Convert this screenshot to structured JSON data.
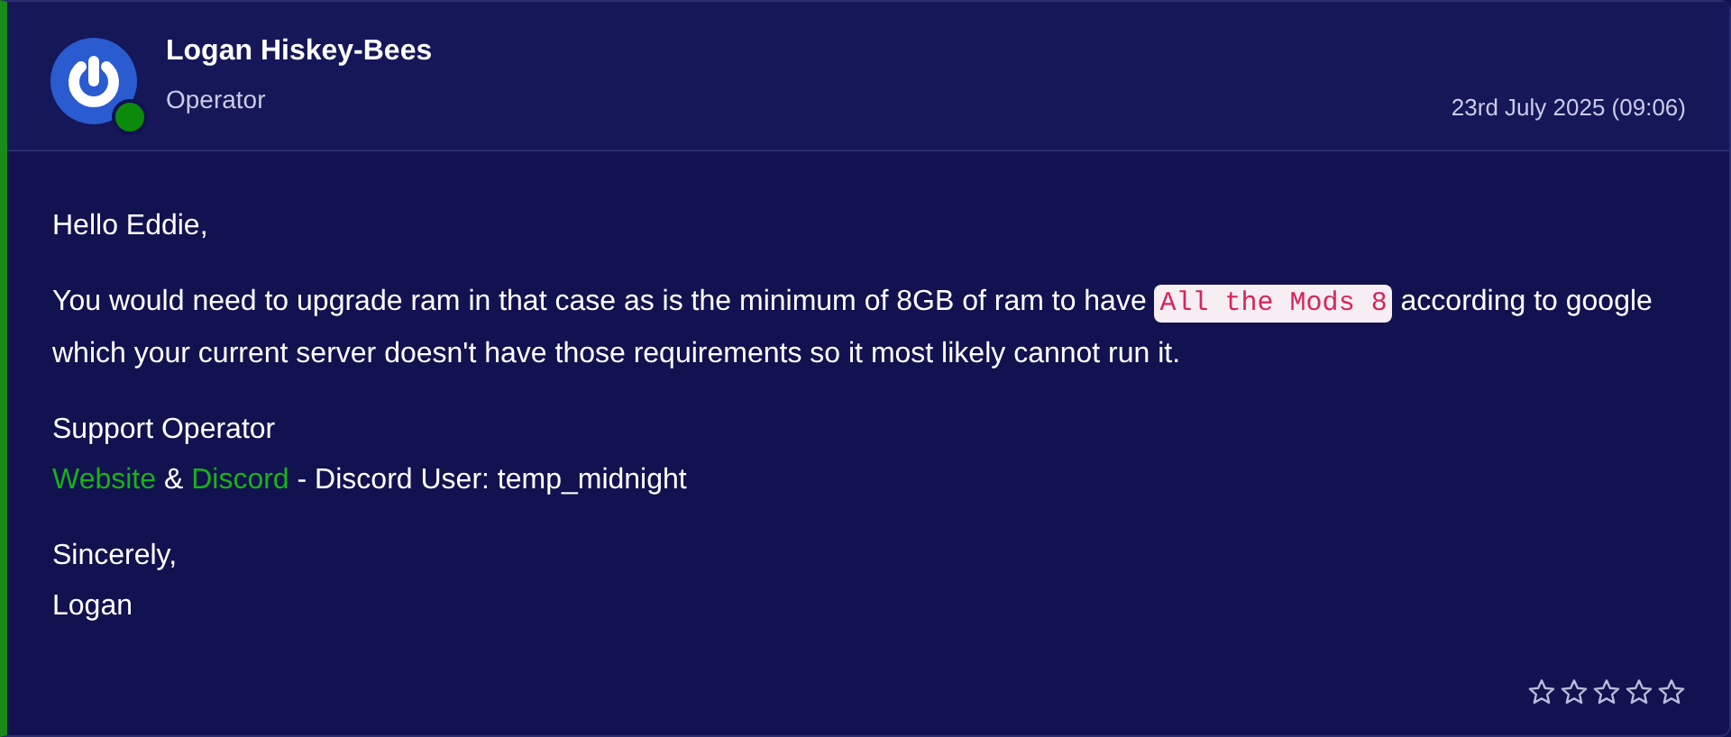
{
  "author": {
    "name": "Logan Hiskey-Bees",
    "role": "Operator",
    "online": true
  },
  "date": "23rd July 2025 (09:06)",
  "greeting": "Hello Eddie,",
  "body": {
    "before": "You would need to upgrade ram in that case as is the minimum of 8GB of ram to have",
    "code": "All the Mods 8",
    "after": "according to google which your current server doesn't have those requirements so it most likely cannot run it."
  },
  "signature_title": "Support Operator",
  "links": [
    {
      "label": "Website"
    },
    {
      "label": "Discord"
    }
  ],
  "link_separator": "&",
  "discord_note": "- Discord User: temp_midnight",
  "closing": [
    "Sincerely,",
    "Logan"
  ],
  "rating": {
    "stars": 0
  }
}
